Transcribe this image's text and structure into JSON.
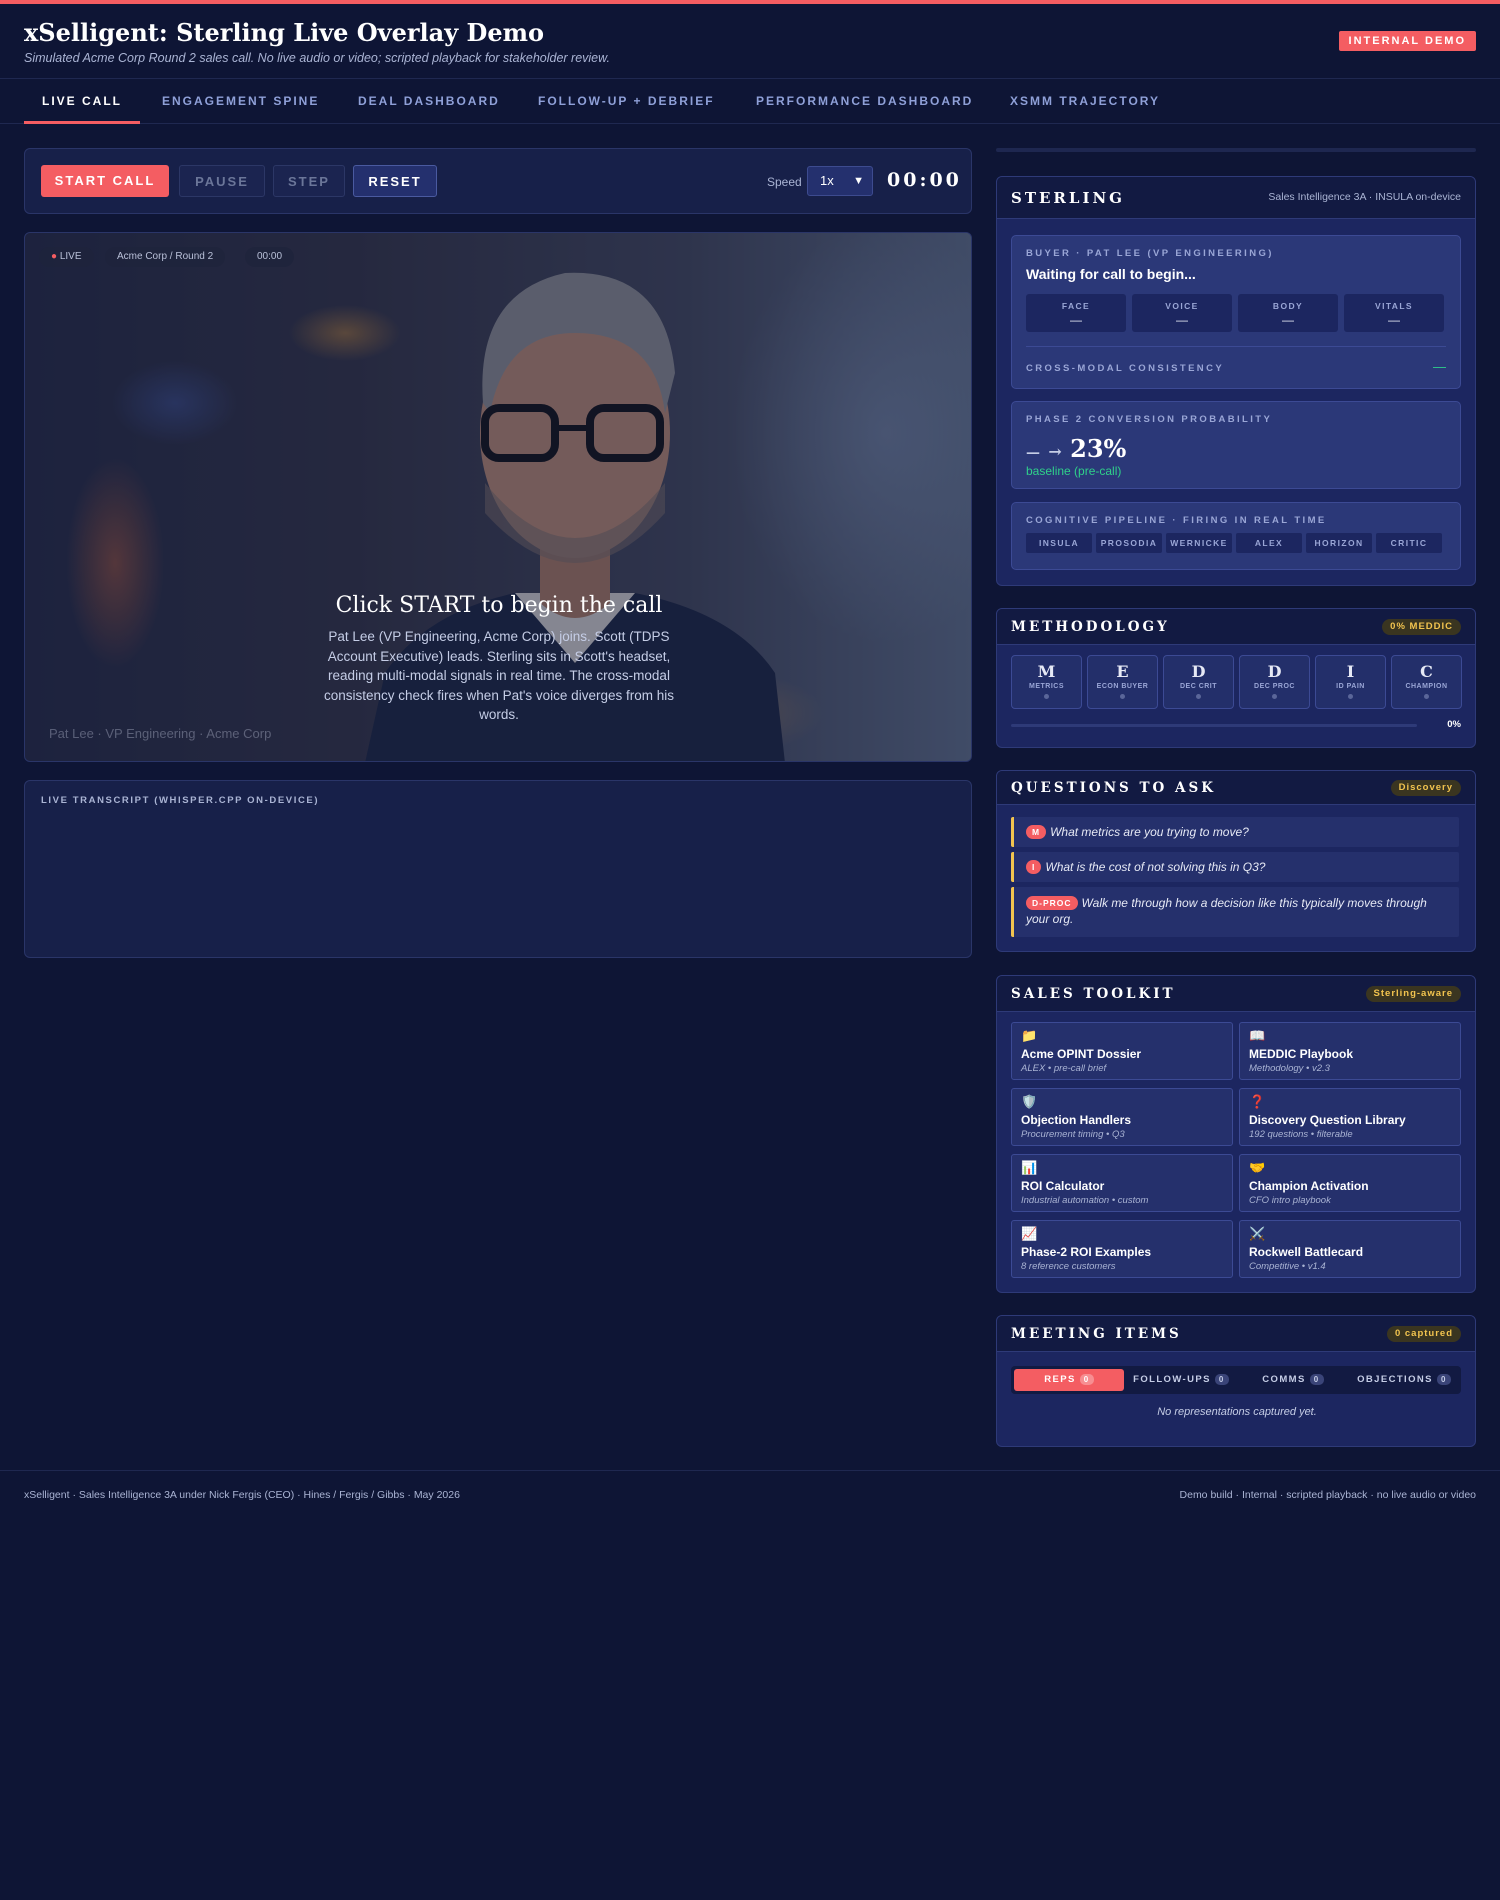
{
  "header": {
    "title": "xSelligent: Sterling Live Overlay Demo",
    "subtitle": "Simulated Acme Corp Round 2 sales call. No live audio or video; scripted playback for stakeholder review.",
    "badge": "INTERNAL DEMO"
  },
  "nav": {
    "tabs": [
      {
        "label": "LIVE CALL",
        "active": true
      },
      {
        "label": "ENGAGEMENT SPINE"
      },
      {
        "label": "DEAL DASHBOARD"
      },
      {
        "label": "FOLLOW-UP + DEBRIEF"
      },
      {
        "label": "PERFORMANCE DASHBOARD"
      },
      {
        "label": "XSMM TRAJECTORY"
      }
    ]
  },
  "controls": {
    "start": "START CALL",
    "pause": "PAUSE",
    "step": "STEP",
    "reset": "RESET",
    "speed_label": "Speed",
    "speed_value": "1x",
    "timer": "00:00"
  },
  "video": {
    "live_chip": "LIVE",
    "meeting_chip": "Acme Corp / Round 2",
    "time_chip": "00:00",
    "caption": "Pat Lee · VP Engineering · Acme Corp",
    "overlay_title": "Click START to begin the call",
    "overlay_text": "Pat Lee (VP Engineering, Acme Corp) joins. Scott (TDPS Account Executive) leads. Sterling sits in Scott's headset, reading multi-modal signals in real time. The cross-modal consistency check fires when Pat's voice diverges from his words."
  },
  "transcript": {
    "label": "LIVE TRANSCRIPT (WHISPER.CPP ON-DEVICE)"
  },
  "sterling": {
    "title": "STERLING",
    "meta": "Sales Intelligence 3A · INSULA on-device",
    "buyer_label": "BUYER · PAT LEE (VP ENGINEERING)",
    "buyer_status": "Waiting for call to begin...",
    "signals": [
      {
        "label": "FACE",
        "value": "—"
      },
      {
        "label": "VOICE",
        "value": "—"
      },
      {
        "label": "BODY",
        "value": "—"
      },
      {
        "label": "VITALS",
        "value": "—"
      }
    ],
    "consistency_label": "CROSS-MODAL CONSISTENCY",
    "consistency_value": "—",
    "probability_label": "PHASE 2 CONVERSION PROBABILITY",
    "probability_from": "—",
    "probability_arrow": "→",
    "probability_value": "23%",
    "probability_note": "baseline (pre-call)",
    "pipeline_label": "COGNITIVE PIPELINE · FIRING IN REAL TIME",
    "pipeline": [
      "INSULA",
      "PROSODIA",
      "WERNICKE",
      "ALEX",
      "HORIZON",
      "CRITIC"
    ]
  },
  "methodology": {
    "title": "METHODOLOGY",
    "badge": "0% MEDDIC",
    "items": [
      {
        "letter": "M",
        "name": "METRICS"
      },
      {
        "letter": "E",
        "name": "ECON BUYER"
      },
      {
        "letter": "D",
        "name": "DEC CRIT"
      },
      {
        "letter": "D",
        "name": "DEC PROC"
      },
      {
        "letter": "I",
        "name": "ID PAIN"
      },
      {
        "letter": "C",
        "name": "CHAMPION"
      }
    ],
    "progress": 0,
    "progress_label": "0%"
  },
  "questions": {
    "title": "QUESTIONS TO ASK",
    "badge": "Discovery",
    "items": [
      {
        "tag": "M",
        "text": "What metrics are you trying to move?"
      },
      {
        "tag": "I",
        "text": "What is the cost of not solving this in Q3?"
      },
      {
        "tag": "D-PROC",
        "text": "Walk me through how a decision like this typically moves through your org."
      }
    ]
  },
  "toolkit": {
    "title": "SALES TOOLKIT",
    "badge": "Sterling-aware",
    "items": [
      {
        "icon": "📁",
        "icon_name": "folder-icon",
        "name": "Acme OPINT Dossier",
        "sub": "ALEX • pre-call brief"
      },
      {
        "icon": "📖",
        "icon_name": "book-icon",
        "name": "MEDDIC Playbook",
        "sub": "Methodology • v2.3"
      },
      {
        "icon": "🛡️",
        "icon_name": "shield-icon",
        "name": "Objection Handlers",
        "sub": "Procurement timing • Q3"
      },
      {
        "icon": "❓",
        "icon_name": "question-icon",
        "name": "Discovery Question Library",
        "sub": "192 questions • filterable"
      },
      {
        "icon": "📊",
        "icon_name": "bar-chart-icon",
        "name": "ROI Calculator",
        "sub": "Industrial automation • custom"
      },
      {
        "icon": "🤝",
        "icon_name": "handshake-icon",
        "name": "Champion Activation",
        "sub": "CFO intro playbook"
      },
      {
        "icon": "📈",
        "icon_name": "trend-chart-icon",
        "name": "Phase-2 ROI Examples",
        "sub": "8 reference customers"
      },
      {
        "icon": "⚔️",
        "icon_name": "swords-icon",
        "name": "Rockwell Battlecard",
        "sub": "Competitive • v1.4"
      }
    ]
  },
  "meeting": {
    "title": "MEETING ITEMS",
    "badge": "0 captured",
    "tabs": [
      {
        "label": "REPS",
        "count": "0",
        "active": true
      },
      {
        "label": "FOLLOW-UPS",
        "count": "0"
      },
      {
        "label": "COMMS",
        "count": "0"
      },
      {
        "label": "OBJECTIONS",
        "count": "0"
      }
    ],
    "empty": "No representations captured yet."
  },
  "footer": {
    "left": "xSelligent · Sales Intelligence 3A under Nick Fergis (CEO) · Hines / Fergis / Gibbs · May 2026",
    "right": "Demo build · Internal · scripted playback · no live audio or video"
  },
  "colors": {
    "accent": "#f45d62",
    "background": "#0e1535",
    "panel": "#1c2660",
    "highlight": "#f2c44f",
    "positive": "#2fd08a"
  }
}
